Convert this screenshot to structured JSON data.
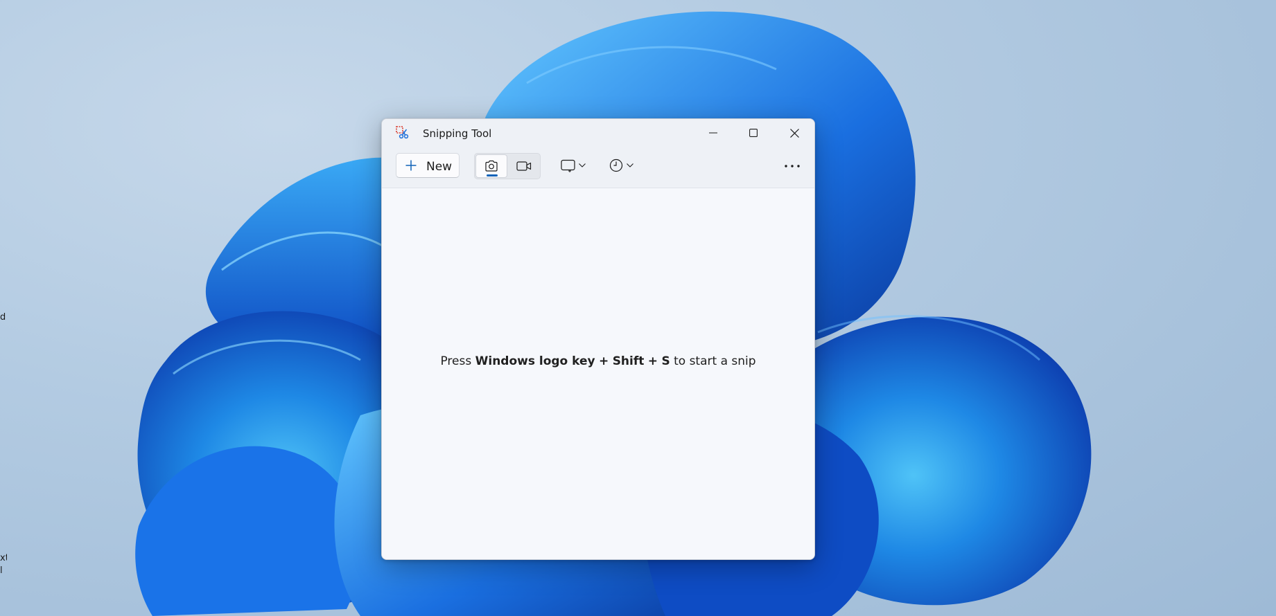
{
  "desktop": {
    "edge_labels": [
      "d",
      "xt",
      "l"
    ]
  },
  "window": {
    "title": "Snipping Tool",
    "icons": {
      "app": "snipping-tool-icon",
      "minimize": "minimize-icon",
      "maximize": "maximize-icon",
      "close": "close-icon"
    }
  },
  "toolbar": {
    "new_label": "New",
    "new_icon": "plus-icon",
    "modes": [
      {
        "name": "Snip",
        "icon": "camera-icon",
        "selected": true
      },
      {
        "name": "Record",
        "icon": "video-camera-icon",
        "selected": false
      }
    ],
    "shape_icon": "rectangle-snip-icon",
    "delay_icon": "clock-icon",
    "more_icon": "more-icon"
  },
  "content": {
    "hint_prefix": "Press",
    "hint_key1": "Windows logo key",
    "hint_plus1": "+",
    "hint_key2": "Shift",
    "hint_plus2": "+",
    "hint_key3": "S",
    "hint_suffix": "to start a snip"
  },
  "colors": {
    "accent": "#0f62b8",
    "window_bg": "#f6f8fc",
    "wallpaper_bg": "#a9c3dd",
    "wallpaper_bloom": "#1f74e6"
  }
}
